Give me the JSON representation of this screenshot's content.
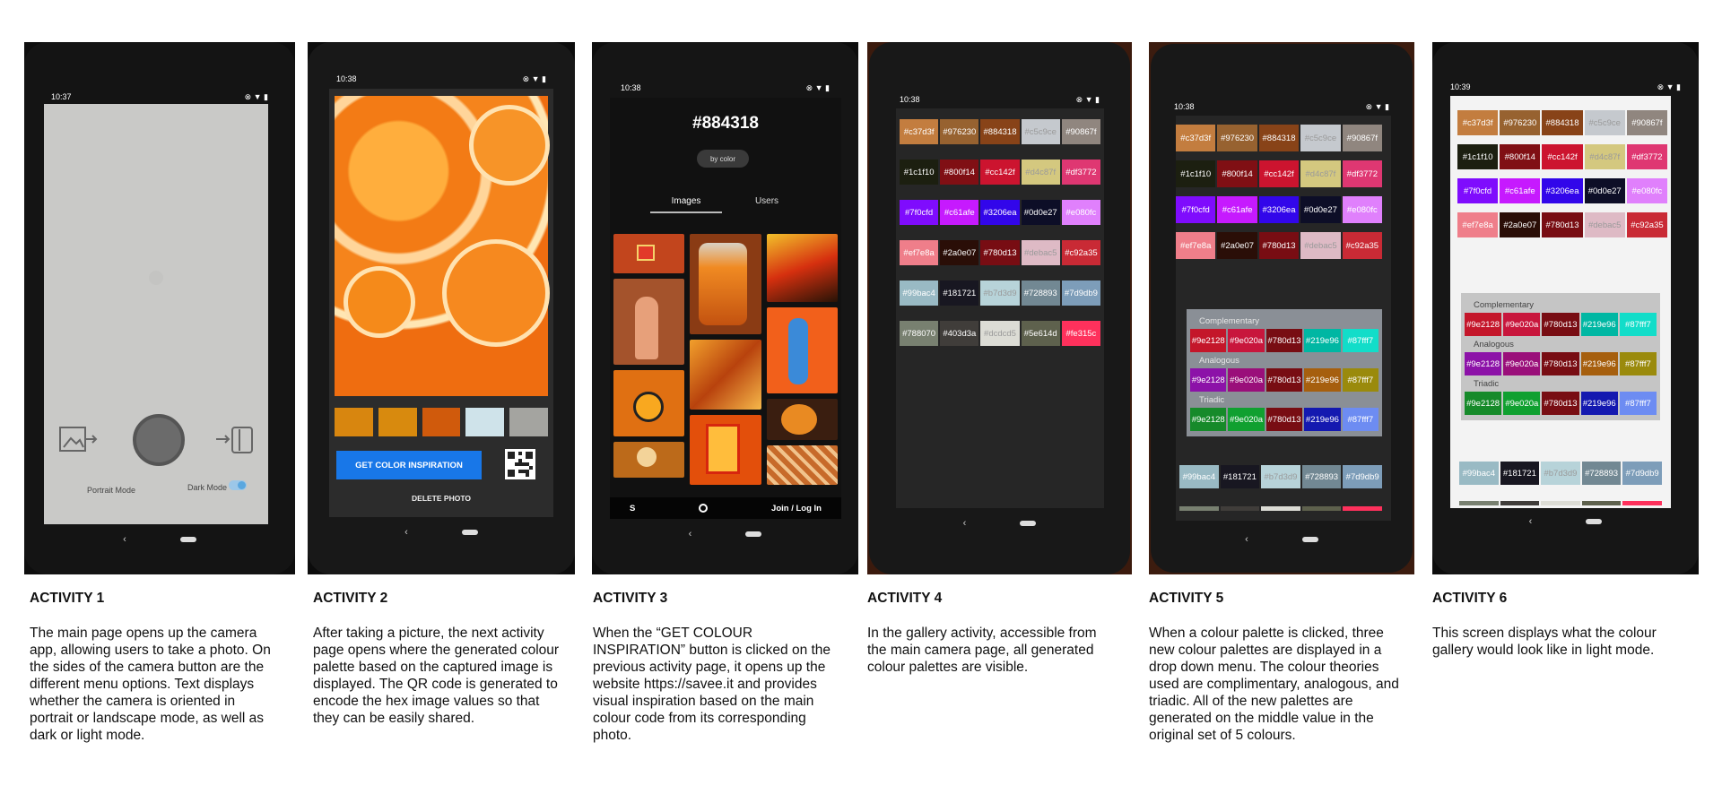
{
  "activities": [
    {
      "title": "ACTIVITY 1",
      "text": "The main page opens up the camera app, allowing users to take a photo.  On the sides of the camera button are the different menu options.  Text displays whether the camera is oriented in portrait or landscape mode, as well as dark or light mode."
    },
    {
      "title": "ACTIVITY 2",
      "text": "After taking a picture, the next activity page opens where the generated colour palette based on the captured image is displayed. The QR code is generated to encode the hex image values so that they can be easily shared."
    },
    {
      "title": "ACTIVITY 3",
      "text": "When the “GET COLOUR INSPIRATION” button is clicked on the previous activity page, it opens up the website https://savee.it and provides visual inspiration based on the main colour code from its corresponding photo."
    },
    {
      "title": "ACTIVITY 4",
      "text": "In the gallery activity, accessible from the main camera page, all generated colour palettes are visible."
    },
    {
      "title": "ACTIVITY 5",
      "text": "When a colour palette is clicked, three new colour palettes are displayed in a drop down menu. The colour theories used are complimentary, analogous, and triadic.  All of the new palettes are generated on the middle value in the original set of 5 colours."
    },
    {
      "title": "ACTIVITY 6",
      "text": "This screen displays what the colour gallery would look like in light mode."
    }
  ],
  "status": {
    "time1": "10:37",
    "time2": "10:38",
    "time3": "10:38",
    "time4": "10:38",
    "time5": "10:38",
    "time6": "10:39",
    "icons": "⊗ ▼ ▮"
  },
  "nav": {
    "back": "‹"
  },
  "screen1": {
    "portrait_label": "Portrait Mode",
    "dark_label": "Dark Mode",
    "gallery_icon": "image-icon",
    "flip_icon": "camera-switch-icon"
  },
  "screen2": {
    "palette": [
      "#d8860f",
      "#d88a0e",
      "#d05a0c",
      "#cfe3ea",
      "#a4a4a0"
    ],
    "inspire_label": "GET COLOR INSPIRATION",
    "delete_label": "DELETE PHOTO"
  },
  "screen3": {
    "hex": "#884318",
    "by_color": "by color",
    "tab_images": "Images",
    "tab_users": "Users",
    "logo": "S",
    "login": "Join / Log In"
  },
  "palettes": [
    [
      "#c37d3f",
      "#976230",
      "#884318",
      "#c5c9ce",
      "#90867f"
    ],
    [
      "#1c1f10",
      "#800f14",
      "#cc142f",
      "#d4c87f",
      "#df3772"
    ],
    [
      "#7f0cfd",
      "#c61afe",
      "#3206ea",
      "#0d0e27",
      "#e080fc"
    ],
    [
      "#ef7e8a",
      "#2a0e07",
      "#780d13",
      "#debac5",
      "#c92a35"
    ],
    [
      "#99bac4",
      "#181721",
      "#b7d3d9",
      "#728893",
      "#7d9db9"
    ],
    [
      "#788070",
      "#403d3a",
      "#dcdcd5",
      "#5e614d",
      "#fe315c"
    ]
  ],
  "theory": {
    "complementary_label": "Complementary",
    "analogous_label": "Analogous",
    "triadic_label": "Triadic",
    "complementary": [
      "#9e2128",
      "#9e020a",
      "#780d13",
      "#219e96",
      "#87fff7"
    ],
    "analogous": [
      "#9e2128",
      "#9e020a",
      "#780d13",
      "#219e96",
      "#87fff7"
    ],
    "triadic": [
      "#9e2128",
      "#9e020a",
      "#780d13",
      "#219e96",
      "#87fff7"
    ]
  },
  "colors": {
    "triadic_bg": [
      "#168a2a",
      "#10a030",
      "#780d13",
      "#1419b0",
      "#6d8cf2"
    ],
    "analogous_bg": [
      "#8c12a8",
      "#9a0f7a",
      "#780d13",
      "#a65f0e",
      "#9a8a0c"
    ],
    "complementary_bg": [
      "#c4162a",
      "#c8163c",
      "#780d13",
      "#00b7a3",
      "#12ddc9"
    ]
  }
}
